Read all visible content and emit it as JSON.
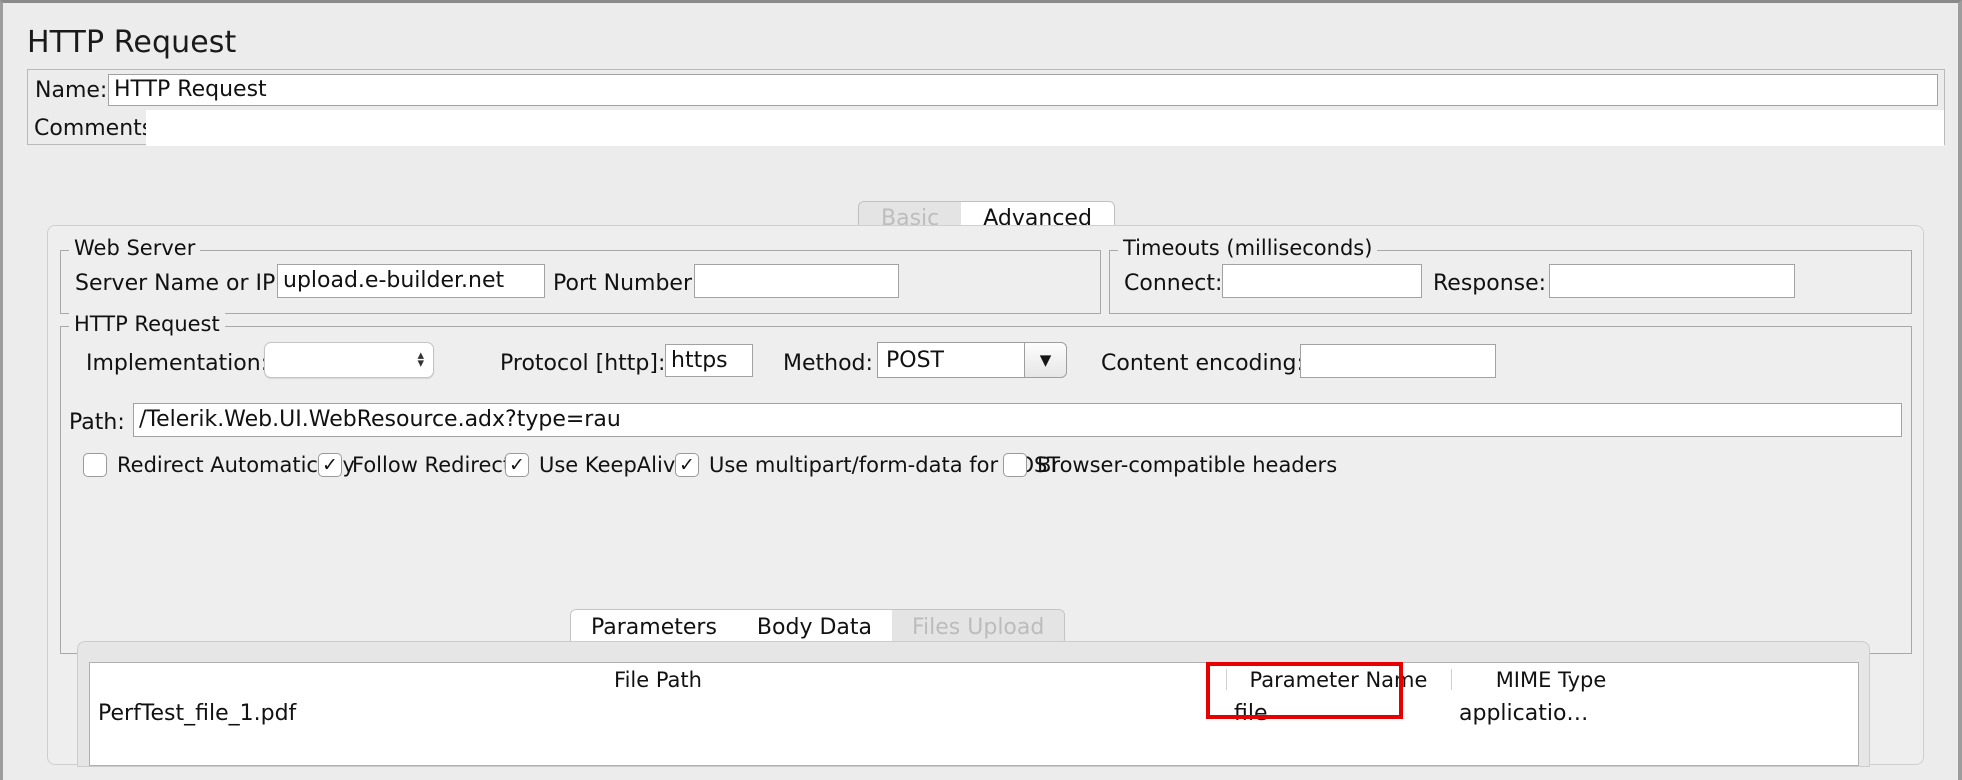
{
  "window": {
    "title": "HTTP Request"
  },
  "meta": {
    "name_label": "Name:",
    "name_value": "HTTP Request",
    "comments_label": "Comments:",
    "comments_value": ""
  },
  "top_tabs": [
    {
      "label": "Basic",
      "state": "inactive"
    },
    {
      "label": "Advanced",
      "state": "active"
    }
  ],
  "web_server": {
    "group_title": "Web Server",
    "server_label": "Server Name or IP:",
    "server_value": "upload.e-builder.net",
    "port_label": "Port Number:",
    "port_value": ""
  },
  "timeouts": {
    "group_title": "Timeouts (milliseconds)",
    "connect_label": "Connect:",
    "connect_value": "",
    "response_label": "Response:",
    "response_value": ""
  },
  "http_request": {
    "group_title": "HTTP Request",
    "implementation_label": "Implementation:",
    "implementation_value": "",
    "protocol_label": "Protocol [http]:",
    "protocol_value": "https",
    "method_label": "Method:",
    "method_value": "POST",
    "content_encoding_label": "Content encoding:",
    "content_encoding_value": "",
    "path_label": "Path:",
    "path_value": "/Telerik.Web.UI.WebResource.adx?type=rau",
    "checkboxes": [
      {
        "label": "Redirect Automatically",
        "checked": false
      },
      {
        "label": "Follow Redirects",
        "checked": true
      },
      {
        "label": "Use KeepAlive",
        "checked": true
      },
      {
        "label": "Use multipart/form-data for POST",
        "checked": true
      },
      {
        "label": "Browser-compatible headers",
        "checked": false
      }
    ]
  },
  "bottom_tabs": [
    {
      "label": "Parameters",
      "state": "active"
    },
    {
      "label": "Body Data",
      "state": "active"
    },
    {
      "label": "Files Upload",
      "state": "inactive"
    }
  ],
  "files_table": {
    "columns": [
      "File Path",
      "Parameter Name",
      "MIME Type"
    ],
    "rows": [
      {
        "file_path": "PerfTest_file_1.pdf",
        "parameter_name": "file",
        "mime_type": "applicatio…"
      }
    ]
  },
  "annotation": {
    "highlight_color": "#e60000",
    "target": "Parameter Name column"
  },
  "icons": {
    "checkmark": "✓",
    "chevron_up": "▴",
    "chevron_down": "▾",
    "dropdown_arrow": "▼"
  }
}
